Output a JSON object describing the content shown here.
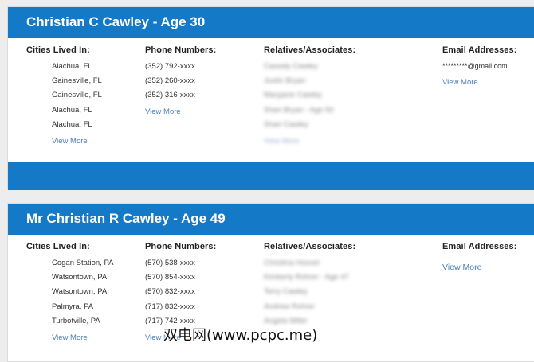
{
  "records": [
    {
      "name": "Christian C Cawley - ",
      "age": "Age 30",
      "headers": {
        "cities": "Cities Lived In:",
        "phones": "Phone Numbers:",
        "relatives": "Relatives/Associates:",
        "emails": "Email Addresses:"
      },
      "cities": [
        "Alachua, FL",
        "Gainesville, FL",
        "Gainesville, FL",
        "Alachua, FL",
        "Alachua, FL"
      ],
      "phones": [
        "(352) 792-xxxx",
        "(352) 260-xxxx",
        "(352) 316-xxxx"
      ],
      "relatives": [
        "Cassidy Cawley",
        "Justin Bryan",
        "Maryjane Cawley",
        "Shari Bryan - Age 50",
        "Shari Cawley"
      ],
      "emails": [
        "*********@gmail.com"
      ],
      "view_more": "View More"
    },
    {
      "name": "Mr Christian R Cawley - ",
      "age": "Age 49",
      "headers": {
        "cities": "Cities Lived In:",
        "phones": "Phone Numbers:",
        "relatives": "Relatives/Associates:",
        "emails": "Email Addresses:"
      },
      "cities": [
        "Cogan Station, PA",
        "Watsontown, PA",
        "Watsontown, PA",
        "Palmyra, PA",
        "Turbotville, PA"
      ],
      "phones": [
        "(570) 538-xxxx",
        "(570) 854-xxxx",
        "(570) 832-xxxx",
        "(717) 832-xxxx",
        "(717) 742-xxxx"
      ],
      "relatives": [
        "Christina Hoover",
        "Kimberly Rohrer - Age 47",
        "Terry Cawley",
        "Andrew Rohrer",
        "Angela Miller"
      ],
      "view_more": "View More"
    }
  ],
  "watermark": "双电网(www.pcpc.me)"
}
